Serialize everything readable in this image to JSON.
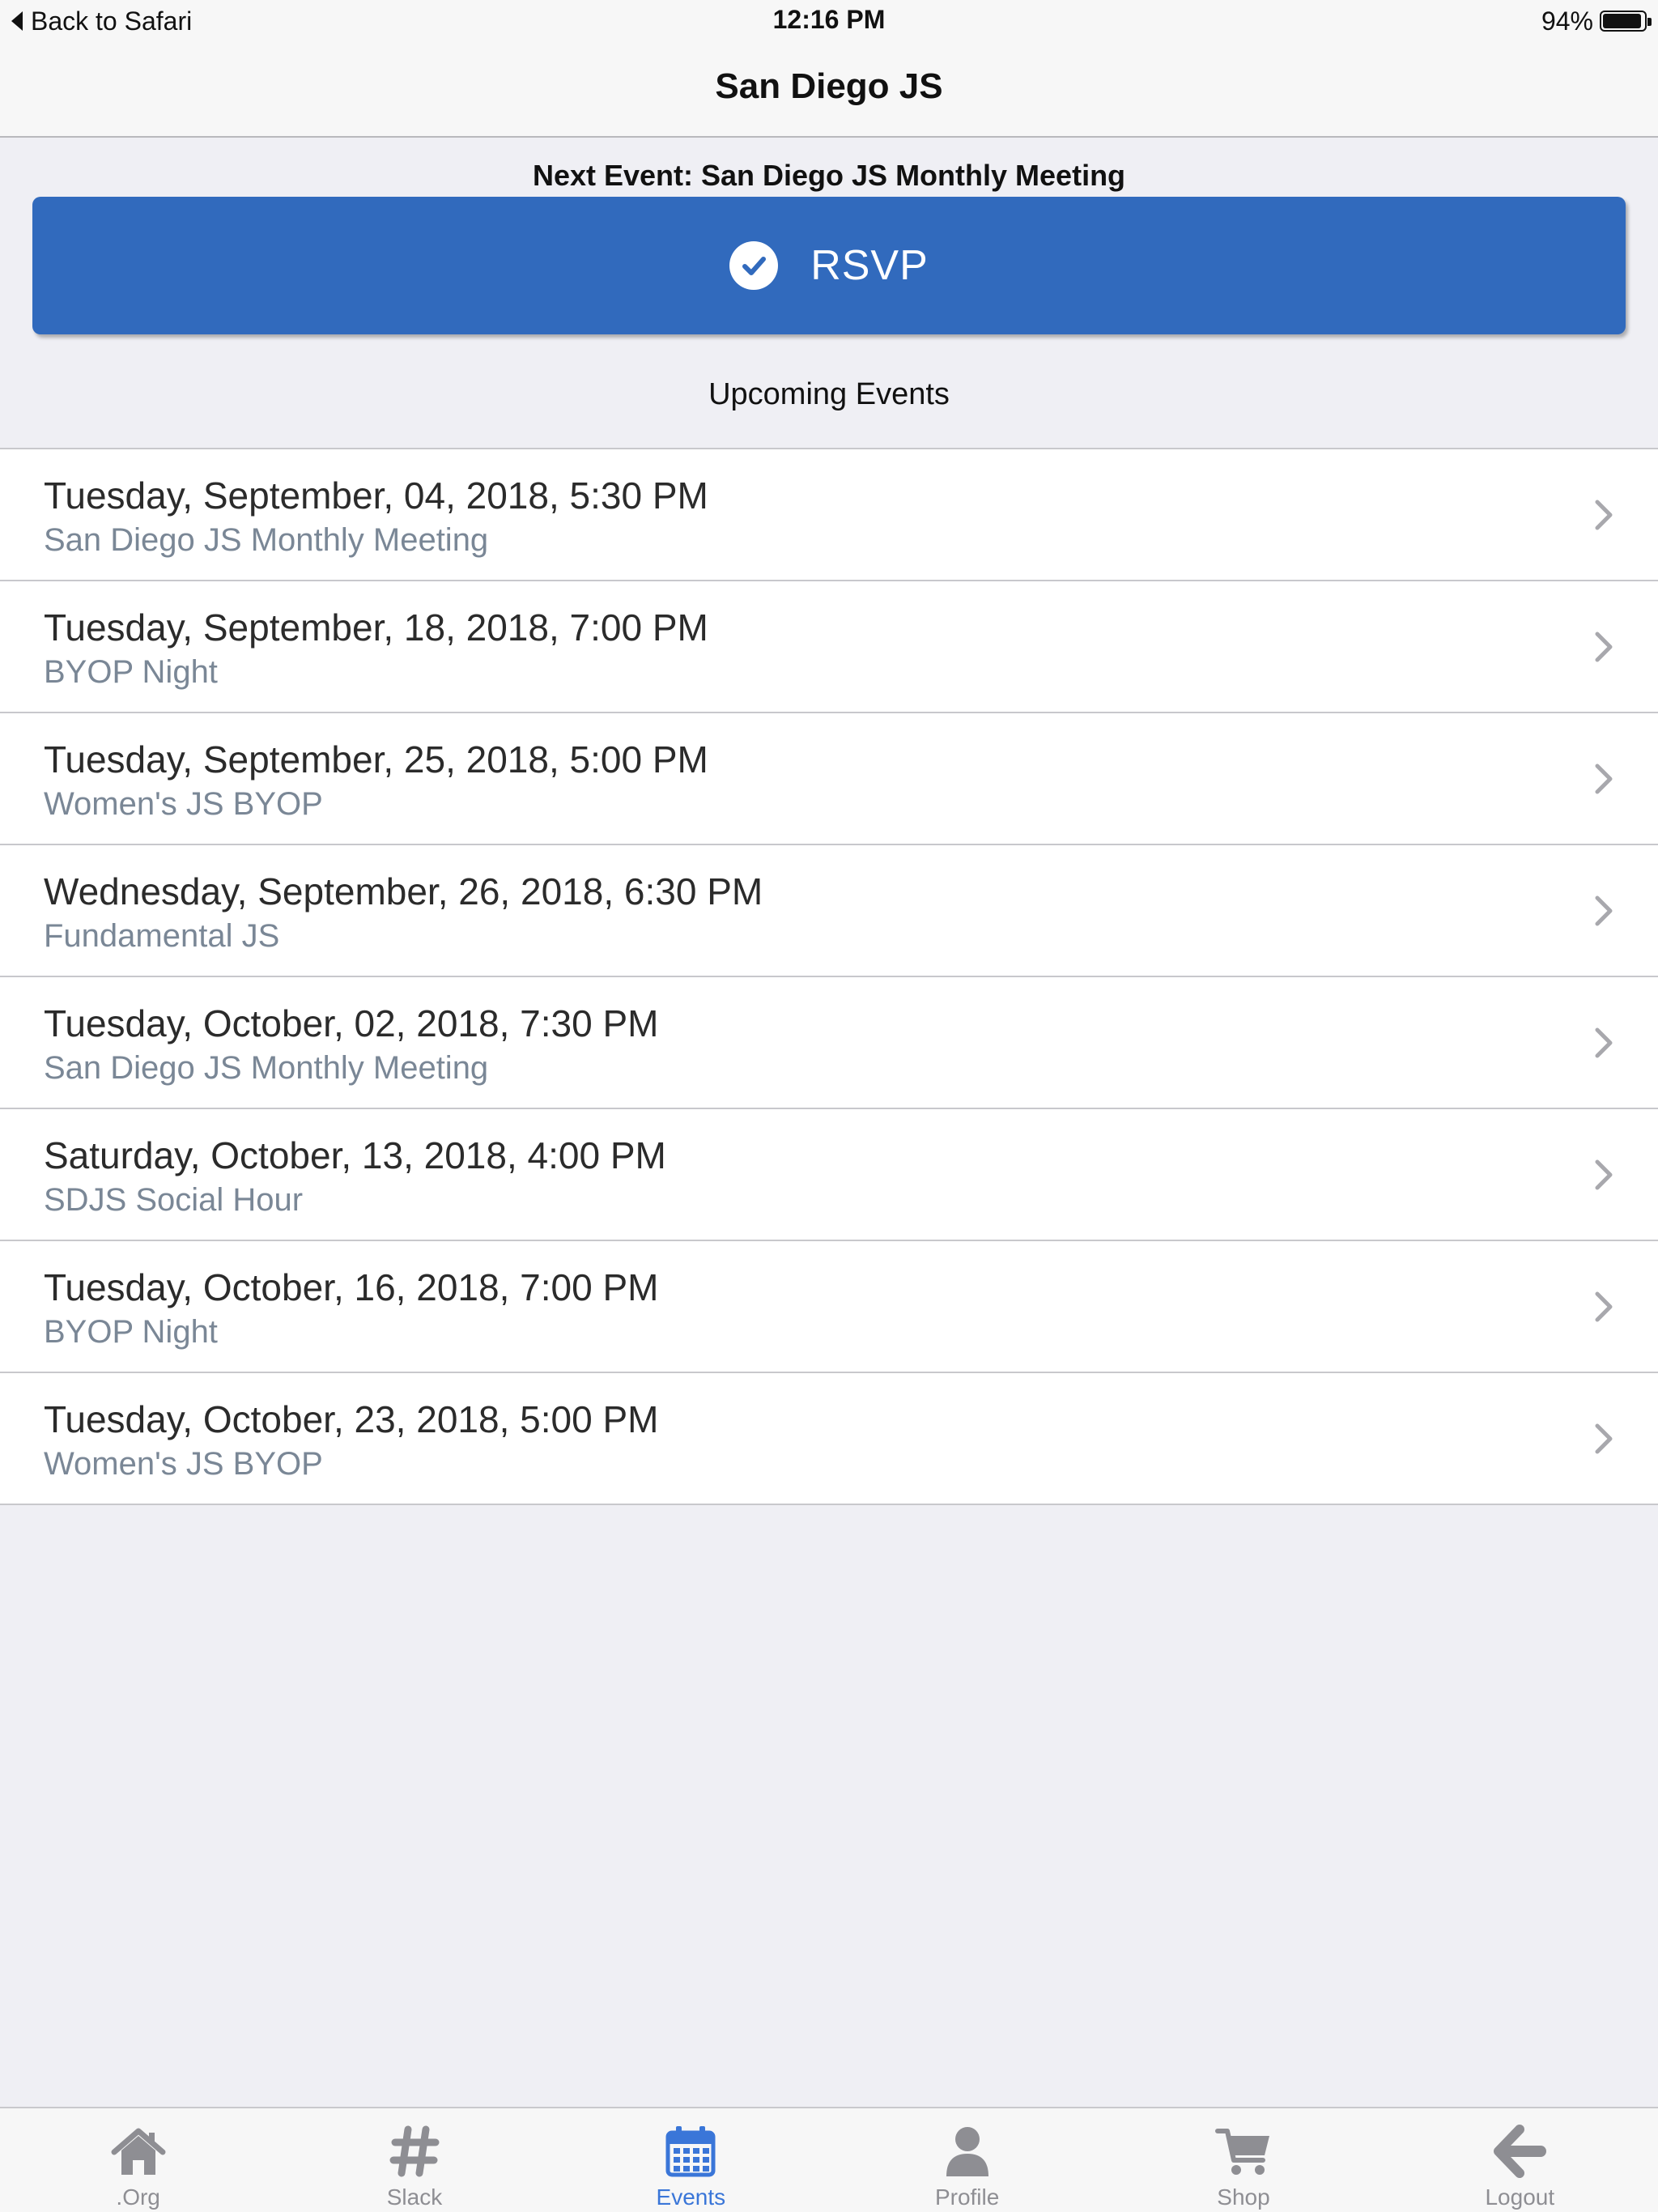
{
  "status_bar": {
    "back_label": "Back to Safari",
    "time": "12:16 PM",
    "battery_percent": "94%",
    "battery_level": 0.94
  },
  "nav": {
    "title": "San Diego JS"
  },
  "next_event": {
    "label": "Next Event: San Diego JS Monthly Meeting",
    "rsvp_label": "RSVP"
  },
  "upcoming_label": "Upcoming Events",
  "events": [
    {
      "date": "Tuesday, September, 04, 2018, 5:30 PM",
      "name": "San Diego JS Monthly Meeting"
    },
    {
      "date": "Tuesday, September, 18, 2018, 7:00 PM",
      "name": "BYOP Night"
    },
    {
      "date": "Tuesday, September, 25, 2018, 5:00 PM",
      "name": "Women's JS BYOP"
    },
    {
      "date": "Wednesday, September, 26, 2018, 6:30 PM",
      "name": "Fundamental JS"
    },
    {
      "date": "Tuesday, October, 02, 2018, 7:30 PM",
      "name": "San Diego JS Monthly Meeting"
    },
    {
      "date": "Saturday, October, 13, 2018, 4:00 PM",
      "name": "SDJS Social Hour"
    },
    {
      "date": "Tuesday, October, 16, 2018, 7:00 PM",
      "name": "BYOP Night"
    },
    {
      "date": "Tuesday, October, 23, 2018, 5:00 PM",
      "name": "Women's JS BYOP"
    }
  ],
  "tabs": [
    {
      "label": ".Org",
      "icon": "home-icon",
      "active": false
    },
    {
      "label": "Slack",
      "icon": "hashtag-icon",
      "active": false
    },
    {
      "label": "Events",
      "icon": "calendar-icon",
      "active": true
    },
    {
      "label": "Profile",
      "icon": "user-icon",
      "active": false
    },
    {
      "label": "Shop",
      "icon": "cart-icon",
      "active": false
    },
    {
      "label": "Logout",
      "icon": "arrow-left-icon",
      "active": false
    }
  ],
  "colors": {
    "accent": "#316abd",
    "tab_active": "#3a76d8",
    "tab_inactive": "#8e8e93",
    "subtitle": "#7a8796"
  }
}
